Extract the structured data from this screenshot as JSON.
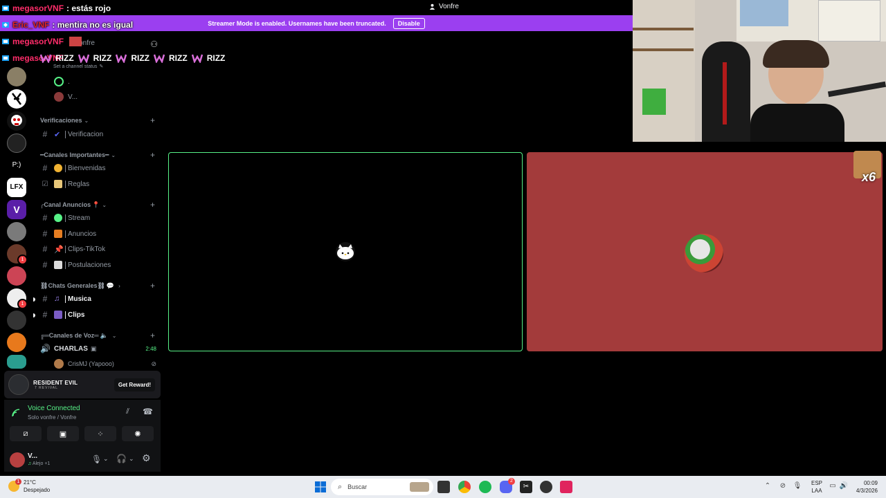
{
  "window": {
    "title": "Vonfre"
  },
  "banner": {
    "text": "Streamer Mode is enabled. Usernames have been truncated.",
    "button": "Disable"
  },
  "overlay_chat": [
    {
      "user": "megasorVNF",
      "message": ": estás rojo",
      "user_color": "#ff2d6a"
    },
    {
      "user": "Eric_VNF",
      "message": ": mentira no es igual",
      "user_color": "#e0242a"
    },
    {
      "user": "megasorVNF",
      "message": "",
      "user_color": "#ff2d6a"
    },
    {
      "user": "megasorVNF",
      "message": "",
      "user_color": "#ff2d6a"
    }
  ],
  "rizz": {
    "words": [
      "RIZZ",
      "RIZZ",
      "RIZZ",
      "RIZZ",
      "RIZZ"
    ]
  },
  "channel_header": {
    "name": "Vonfre",
    "status_hint": "Set a channel status"
  },
  "voice_users_top": [
    ".",
    "V..."
  ],
  "categories": {
    "verificaciones": "Verificaciones",
    "importantes": "Canales Importantes",
    "anuncios": "Canal Anuncios",
    "generales": "Chats Generales",
    "voz": "Canales de Voz"
  },
  "channels": {
    "verificacion": "Verificacion",
    "bienvenidas": "Bienvenidas",
    "reglas": "Reglas",
    "stream": "Stream",
    "anuncios": "Anuncios",
    "clips_tiktok": "Clips-TikTok",
    "postulaciones": "Postulaciones",
    "musica": "Musica",
    "clips": "Clips"
  },
  "voice_channel": {
    "name": "CHARLAS",
    "time": "2:48",
    "member": "CrisMJ (Yapooo)"
  },
  "reward": {
    "game": "RESIDENT EVIL",
    "subtitle": "7 REVIVAL",
    "button": "Get Reward!"
  },
  "voice_status": {
    "title": "Voice Connected",
    "subtitle": "Solo vonfre / Vonfre"
  },
  "user_panel": {
    "name": "V...",
    "status": "Alejo +1"
  },
  "tile_overlay": {
    "multiplier": "x6"
  },
  "taskbar": {
    "temp": "21°C",
    "weather": "Despejado",
    "weather_badge": "1",
    "search_placeholder": "Buscar",
    "lang_top": "ESP",
    "lang_bottom": "LAA",
    "time": "00:09",
    "date": "4/3/2026",
    "discord_badge": "2"
  },
  "colors": {
    "banner": "#9b3ff0",
    "voice_green": "#57f287",
    "tile_right": "#a33b3b"
  }
}
